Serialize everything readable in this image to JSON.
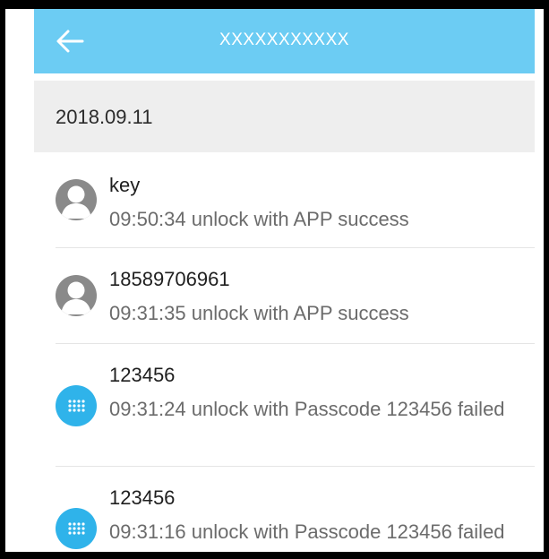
{
  "header": {
    "back_icon": "arrow-left-icon",
    "title": "XXXXXXXXXXX",
    "background_color": "#6cccf3"
  },
  "date_section": {
    "date": "2018.09.11"
  },
  "records": [
    {
      "name": "key",
      "icon": "user-avatar-icon",
      "description": "09:50:34 unlock with APP success"
    },
    {
      "name": "18589706961",
      "icon": "user-avatar-icon",
      "description": "09:31:35 unlock with APP success"
    },
    {
      "name": "123456",
      "icon": "keypad-icon",
      "description": "09:31:24 unlock with Passcode 123456 failed"
    },
    {
      "name": "123456",
      "icon": "keypad-icon",
      "description": "09:31:16 unlock with Passcode 123456 failed"
    }
  ],
  "colors": {
    "keypad_icon": "#2fb3ea",
    "avatar_icon": "#8a8a8a"
  }
}
